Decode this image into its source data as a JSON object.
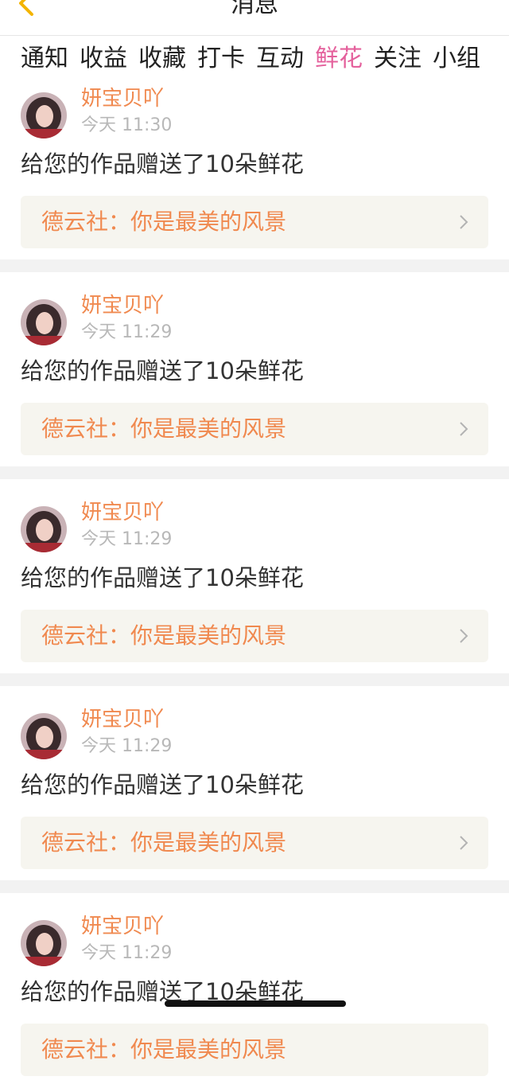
{
  "header": {
    "title": "消息",
    "back_icon": "chevron-left-icon"
  },
  "tabs": [
    {
      "label": "通知",
      "active": false
    },
    {
      "label": "收益",
      "active": false
    },
    {
      "label": "收藏",
      "active": false
    },
    {
      "label": "打卡",
      "active": false
    },
    {
      "label": "互动",
      "active": false
    },
    {
      "label": "鲜花",
      "active": true
    },
    {
      "label": "关注",
      "active": false
    },
    {
      "label": "小组",
      "active": false
    }
  ],
  "colors": {
    "accent_pink": "#e4609c",
    "accent_orange": "#f0894f",
    "card_bg": "#f6f5ef",
    "separator": "#f2f2f2"
  },
  "notifications": [
    {
      "user": "妍宝贝吖",
      "time": "今天 11:30",
      "message": "给您的作品赠送了10朵鲜花",
      "work": "德云社：你是最美的风景"
    },
    {
      "user": "妍宝贝吖",
      "time": "今天 11:29",
      "message": "给您的作品赠送了10朵鲜花",
      "work": "德云社：你是最美的风景"
    },
    {
      "user": "妍宝贝吖",
      "time": "今天 11:29",
      "message": "给您的作品赠送了10朵鲜花",
      "work": "德云社：你是最美的风景"
    },
    {
      "user": "妍宝贝吖",
      "time": "今天 11:29",
      "message": "给您的作品赠送了10朵鲜花",
      "work": "德云社：你是最美的风景"
    },
    {
      "user": "妍宝贝吖",
      "time": "今天 11:29",
      "message": "给您的作品赠送了10朵鲜花",
      "work": "德云社：你是最美的风景"
    }
  ]
}
